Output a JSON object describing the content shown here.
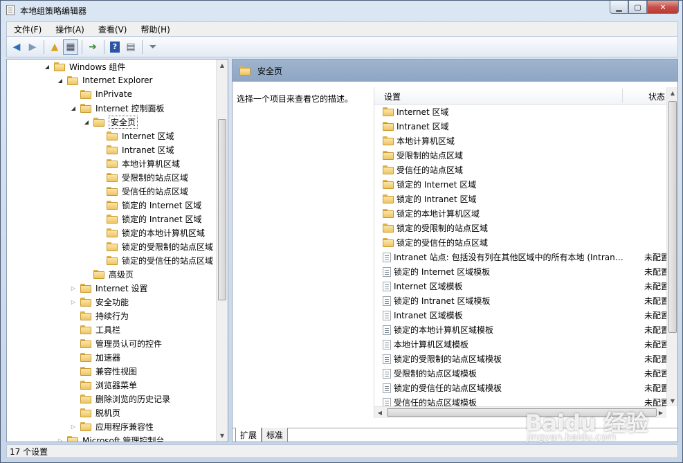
{
  "window": {
    "title": "本地组策略编辑器"
  },
  "menu": [
    "文件(F)",
    "操作(A)",
    "查看(V)",
    "帮助(H)"
  ],
  "toolbar": [
    "back-icon",
    "forward-icon",
    "up-folder-icon",
    "show-hide-tree-icon",
    "export-list-icon",
    "help-icon",
    "properties-icon",
    "filter-icon"
  ],
  "tree": [
    {
      "label": "Windows 组件",
      "level": 3,
      "expander": "expanded",
      "folder": true
    },
    {
      "label": "Internet Explorer",
      "level": 4,
      "expander": "expanded",
      "folder": true
    },
    {
      "label": "InPrivate",
      "level": 5,
      "expander": "none",
      "folder": true
    },
    {
      "label": "Internet 控制面板",
      "level": 5,
      "expander": "expanded",
      "folder": true
    },
    {
      "label": "安全页",
      "level": 6,
      "expander": "expanded",
      "folder": true,
      "selected": true
    },
    {
      "label": "Internet 区域",
      "level": 7,
      "expander": "none",
      "folder": true
    },
    {
      "label": "Intranet 区域",
      "level": 7,
      "expander": "none",
      "folder": true
    },
    {
      "label": "本地计算机区域",
      "level": 7,
      "expander": "none",
      "folder": true
    },
    {
      "label": "受限制的站点区域",
      "level": 7,
      "expander": "none",
      "folder": true
    },
    {
      "label": "受信任的站点区域",
      "level": 7,
      "expander": "none",
      "folder": true
    },
    {
      "label": "锁定的 Internet 区域",
      "level": 7,
      "expander": "none",
      "folder": true
    },
    {
      "label": "锁定的 Intranet 区域",
      "level": 7,
      "expander": "none",
      "folder": true
    },
    {
      "label": "锁定的本地计算机区域",
      "level": 7,
      "expander": "none",
      "folder": true
    },
    {
      "label": "锁定的受限制的站点区域",
      "level": 7,
      "expander": "none",
      "folder": true
    },
    {
      "label": "锁定的受信任的站点区域",
      "level": 7,
      "expander": "none",
      "folder": true
    },
    {
      "label": "高级页",
      "level": 6,
      "expander": "none",
      "folder": true
    },
    {
      "label": "Internet 设置",
      "level": 5,
      "expander": "collapsed",
      "folder": true
    },
    {
      "label": "安全功能",
      "level": 5,
      "expander": "collapsed",
      "folder": true
    },
    {
      "label": "持续行为",
      "level": 5,
      "expander": "none",
      "folder": true
    },
    {
      "label": "工具栏",
      "level": 5,
      "expander": "none",
      "folder": true
    },
    {
      "label": "管理员认可的控件",
      "level": 5,
      "expander": "none",
      "folder": true
    },
    {
      "label": "加速器",
      "level": 5,
      "expander": "none",
      "folder": true
    },
    {
      "label": "兼容性视图",
      "level": 5,
      "expander": "none",
      "folder": true
    },
    {
      "label": "浏览器菜单",
      "level": 5,
      "expander": "none",
      "folder": true
    },
    {
      "label": "删除浏览的历史记录",
      "level": 5,
      "expander": "none",
      "folder": true
    },
    {
      "label": "脱机页",
      "level": 5,
      "expander": "none",
      "folder": true
    },
    {
      "label": "应用程序兼容性",
      "level": 5,
      "expander": "collapsed",
      "folder": true
    },
    {
      "label": "Microsoft 管理控制台",
      "level": 4,
      "expander": "collapsed",
      "folder": true
    }
  ],
  "right": {
    "header_title": "安全页",
    "description": "选择一个项目来查看它的描述。",
    "col_setting": "设置",
    "col_state": "状态",
    "rows": [
      {
        "type": "folder",
        "name": "Internet 区域",
        "state": ""
      },
      {
        "type": "folder",
        "name": "Intranet 区域",
        "state": ""
      },
      {
        "type": "folder",
        "name": "本地计算机区域",
        "state": ""
      },
      {
        "type": "folder",
        "name": "受限制的站点区域",
        "state": ""
      },
      {
        "type": "folder",
        "name": "受信任的站点区域",
        "state": ""
      },
      {
        "type": "folder",
        "name": "锁定的 Internet 区域",
        "state": ""
      },
      {
        "type": "folder",
        "name": "锁定的 Intranet 区域",
        "state": ""
      },
      {
        "type": "folder",
        "name": "锁定的本地计算机区域",
        "state": ""
      },
      {
        "type": "folder",
        "name": "锁定的受限制的站点区域",
        "state": ""
      },
      {
        "type": "folder",
        "name": "锁定的受信任的站点区域",
        "state": ""
      },
      {
        "type": "setting",
        "name": "Intranet 站点: 包括没有列在其他区域中的所有本地 (Intran…",
        "state": "未配置"
      },
      {
        "type": "setting",
        "name": "锁定的 Internet 区域模板",
        "state": "未配置"
      },
      {
        "type": "setting",
        "name": "Internet 区域模板",
        "state": "未配置"
      },
      {
        "type": "setting",
        "name": "锁定的 Intranet 区域模板",
        "state": "未配置"
      },
      {
        "type": "setting",
        "name": "Intranet 区域模板",
        "state": "未配置"
      },
      {
        "type": "setting",
        "name": "锁定的本地计算机区域模板",
        "state": "未配置"
      },
      {
        "type": "setting",
        "name": "本地计算机区域模板",
        "state": "未配置"
      },
      {
        "type": "setting",
        "name": "锁定的受限制的站点区域模板",
        "state": "未配置"
      },
      {
        "type": "setting",
        "name": "受限制的站点区域模板",
        "state": "未配置"
      },
      {
        "type": "setting",
        "name": "锁定的受信任的站点区域模板",
        "state": "未配置"
      },
      {
        "type": "setting",
        "name": "受信任的站点区域模板",
        "state": "未配置"
      }
    ],
    "tabs": [
      "扩展",
      "标准"
    ]
  },
  "status": "17 个设置",
  "watermark": {
    "logo": "Baidu 经验",
    "url": "jingyan.baidu.com"
  }
}
